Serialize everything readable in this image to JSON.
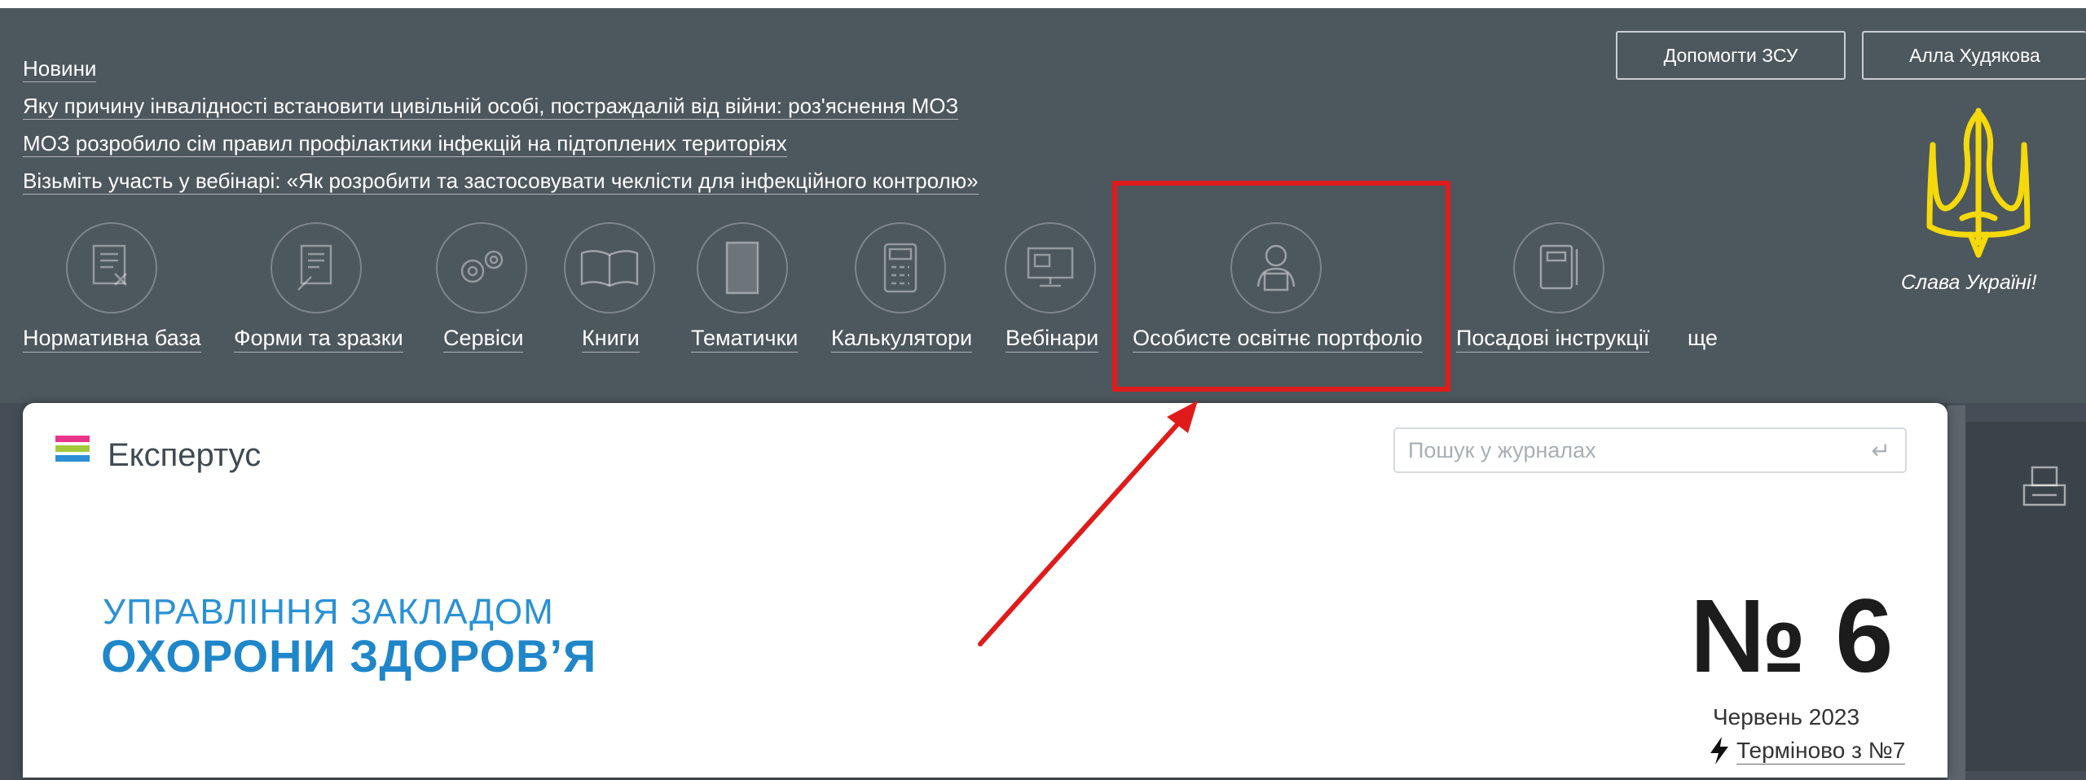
{
  "news": {
    "title": "Новини",
    "items": [
      "Яку причину інвалідності встановити цивільній особі, постраждалій від війни: роз'яснення МОЗ",
      "МОЗ розробило сім правил профілактики інфекцій на підтоплених територіях",
      "Візьміть участь у вебінарі: «Як розробити та застосовувати чеклісти для інфекційного контролю»"
    ]
  },
  "top_buttons": {
    "help": "Допомогти ЗСУ",
    "user": "Алла Худякова"
  },
  "emblem": {
    "slogan": "Слава Україні!"
  },
  "nav": [
    {
      "label": "Нормативна база",
      "icon": "document-icon"
    },
    {
      "label": "Форми та зразки",
      "icon": "form-icon"
    },
    {
      "label": "Сервіси",
      "icon": "gears-icon"
    },
    {
      "label": "Книги",
      "icon": "book-icon"
    },
    {
      "label": "Тематички",
      "icon": "notebook-icon"
    },
    {
      "label": "Калькулятори",
      "icon": "calculator-icon"
    },
    {
      "label": "Вебінари",
      "icon": "monitor-icon"
    },
    {
      "label": "Особисте освітнє портфоліо",
      "icon": "user-icon"
    },
    {
      "label": "Посадові інструкції",
      "icon": "instruction-icon"
    },
    {
      "label": "ще"
    }
  ],
  "annotation": {
    "highlight_color": "#e01b1b",
    "highlighted": "Особисте освітнє портфоліо"
  },
  "brand": {
    "name": "Експертус",
    "colors": [
      "#e8358a",
      "#a2c83b",
      "#2c8fd6"
    ]
  },
  "search": {
    "placeholder": "Пошук у журналах"
  },
  "journal": {
    "line1": "УПРАВЛІННЯ ЗАКЛАДОМ",
    "line2": "ОХОРОНИ ЗДОРОВ’Я",
    "issue": "№ 6",
    "month": "Червень 2023",
    "urgent": "Терміново з №7"
  }
}
